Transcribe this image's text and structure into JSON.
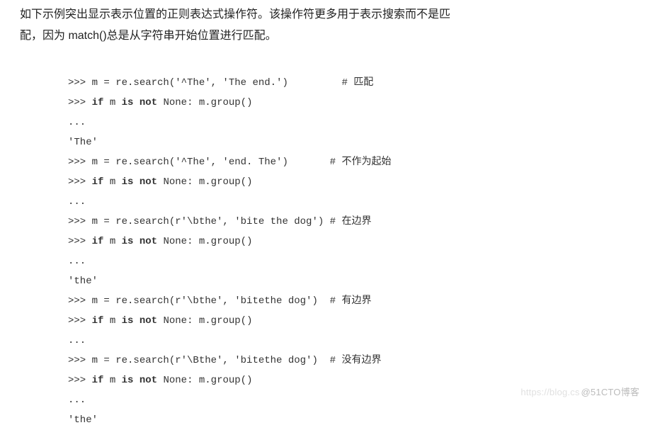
{
  "paragraph": {
    "line1_indent": "如下示例突出显示表示位置的正则表达式操作符。该操作符更多用于表示搜索而不是匹",
    "line2": "配，因为 match()总是从字符串开始位置进行匹配。"
  },
  "code": {
    "l01_a": ">>> m = re.search('^The', 'The end.')         # 匹配",
    "l02_a": ">>> ",
    "l02_b": "if",
    "l02_c": " m ",
    "l02_d": "is not",
    "l02_e": " None: m.group()",
    "l03": "...",
    "l04": "'The'",
    "l05_a": ">>> m = re.search('^The', 'end. The')       # 不作为起始",
    "l06_a": ">>> ",
    "l06_b": "if",
    "l06_c": " m ",
    "l06_d": "is not",
    "l06_e": " None: m.group()",
    "l07": "...",
    "l08_a": ">>> m = re.search(r'\\bthe', 'bite the dog') # 在边界",
    "l09_a": ">>> ",
    "l09_b": "if",
    "l09_c": " m ",
    "l09_d": "is not",
    "l09_e": " None: m.group()",
    "l10": "...",
    "l11": "'the'",
    "l12_a": ">>> m = re.search(r'\\bthe', 'bitethe dog')  # 有边界",
    "l13_a": ">>> ",
    "l13_b": "if",
    "l13_c": " m ",
    "l13_d": "is not",
    "l13_e": " None: m.group()",
    "l14": "...",
    "l15_a": ">>> m = re.search(r'\\Bthe', 'bitethe dog')  # 没有边界",
    "l16_a": ">>> ",
    "l16_b": "if",
    "l16_c": " m ",
    "l16_d": "is not",
    "l16_e": " None: m.group()",
    "l17": "...",
    "l18": "'the'"
  },
  "watermark": {
    "faint": "https://blog.cs",
    "text": "@51CTO博客"
  }
}
